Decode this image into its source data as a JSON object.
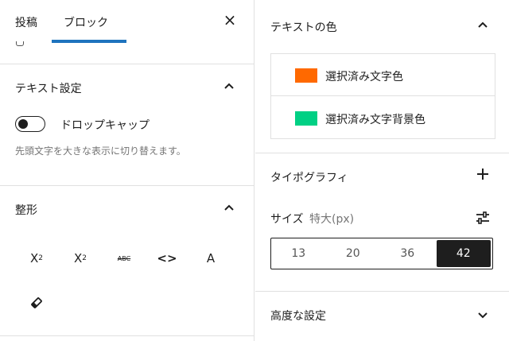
{
  "tabs": {
    "post": "投稿",
    "block": "ブロック"
  },
  "close_symbol": "×",
  "text_settings": {
    "title": "テキスト設定",
    "toggle_label": "ドロップキャップ",
    "help": "先頭文字を大きな表示に切り替えます。"
  },
  "formatting": {
    "title": "整形",
    "buttons": {
      "superscript_base": "X",
      "superscript_exp": "2",
      "subscript_base": "X",
      "subscript_exp": "2",
      "strike": "ABC",
      "code": "<>",
      "text": "A"
    }
  },
  "text_color": {
    "title": "テキストの色",
    "items": [
      {
        "label": "選択済み文字色",
        "color": "#ff6900"
      },
      {
        "label": "選択済み文字背景色",
        "color": "#00d084"
      }
    ]
  },
  "typography": {
    "title": "タイポグラフィ",
    "size_label": "サイズ",
    "size_value": "特大(px)",
    "sizes": [
      "13",
      "20",
      "36",
      "42"
    ],
    "selected": "42"
  },
  "advanced": {
    "title": "高度な設定"
  },
  "colors": {
    "accent": "#1e73be",
    "border": "#e0e0e0",
    "text": "#1e1e1e",
    "muted": "#757575"
  }
}
